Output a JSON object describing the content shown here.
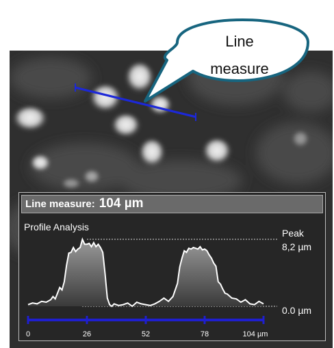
{
  "callout": {
    "line1": "Line",
    "line2": "measure"
  },
  "measurement": {
    "label": "Line measure:",
    "value": "104 µm"
  },
  "profile": {
    "title": "Profile Analysis",
    "peak_label": "Peak",
    "peak_value": "8,2 µm",
    "baseline_value": "0.0 µm"
  },
  "chart_data": {
    "type": "line",
    "title": "Profile Analysis",
    "x_ticks": [
      "0",
      "26",
      "52",
      "78",
      "104 µm"
    ],
    "xlim": [
      0,
      104
    ],
    "ylim": [
      0,
      8.2
    ],
    "series": [
      {
        "x": [
          0,
          2,
          4,
          6,
          8,
          10,
          11,
          12,
          13,
          14,
          15,
          16,
          17,
          18,
          19,
          20,
          21,
          22,
          23,
          24,
          25,
          26,
          27,
          28,
          29,
          30,
          31,
          32,
          33,
          34,
          35,
          36,
          37,
          38,
          40,
          42,
          44,
          46,
          48,
          50,
          52,
          54,
          56,
          58,
          60,
          62,
          64,
          66,
          67,
          68,
          69,
          70,
          71,
          72,
          73,
          74,
          75,
          76,
          77,
          78,
          79,
          80,
          81,
          82,
          83,
          84,
          85,
          86,
          87,
          88,
          90,
          92,
          94,
          96,
          98,
          100,
          102,
          104
        ],
        "y": [
          0.2,
          0.4,
          0.3,
          0.6,
          0.5,
          0.8,
          1.2,
          0.9,
          1.6,
          2.3,
          2.0,
          3.0,
          5.0,
          6.5,
          6.6,
          7.2,
          6.7,
          7.0,
          7.2,
          8.2,
          7.6,
          7.6,
          7.7,
          7.3,
          7.8,
          7.3,
          7.6,
          7.2,
          6.6,
          4.0,
          1.0,
          0.2,
          0.0,
          0.3,
          0.1,
          0.2,
          0.4,
          0.0,
          0.5,
          0.3,
          0.2,
          0.1,
          0.3,
          0.6,
          1.0,
          0.6,
          1.2,
          2.8,
          4.8,
          5.9,
          6.8,
          6.6,
          7.1,
          7.0,
          7.2,
          7.1,
          7.0,
          7.3,
          6.9,
          7.0,
          6.8,
          6.3,
          5.9,
          5.3,
          4.9,
          3.0,
          2.7,
          2.1,
          1.6,
          1.5,
          1.0,
          0.9,
          0.5,
          0.8,
          0.3,
          0.2,
          0.6,
          0.3
        ]
      }
    ]
  },
  "colors": {
    "measure_line": "#1c28d8",
    "scale_bar": "#1f1fcf",
    "callout_border": "#17657f",
    "profile_line": "#ffffff"
  }
}
